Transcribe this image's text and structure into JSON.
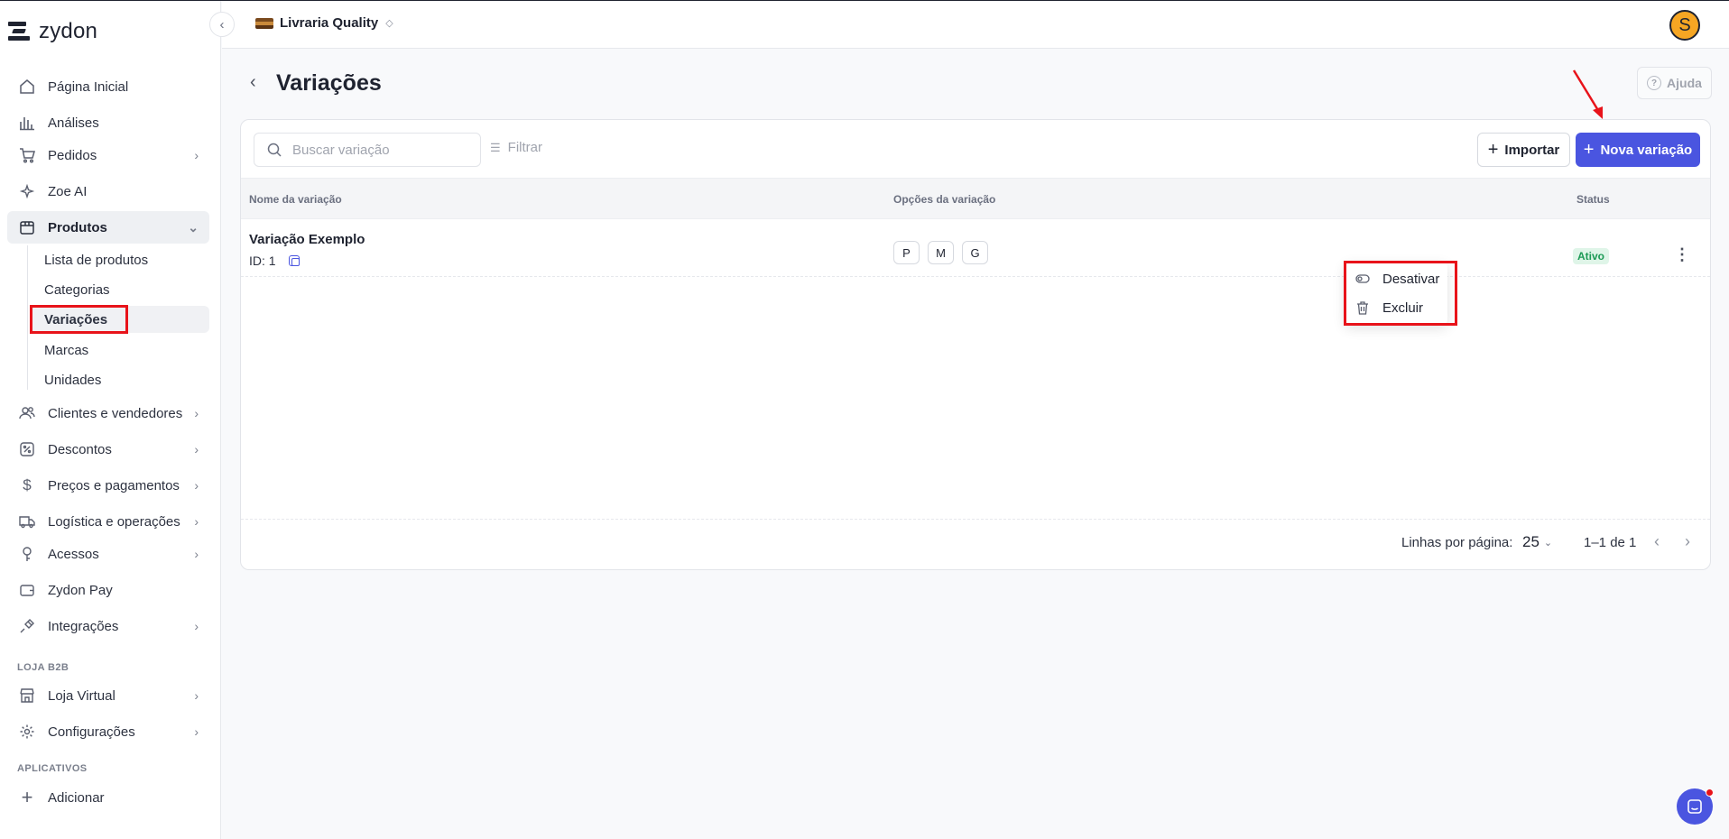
{
  "app": {
    "logo_text": "zydon",
    "store_name": "Livraria Quality",
    "avatar_initial": "S"
  },
  "sidebar": {
    "items": [
      {
        "label": "Página Inicial",
        "icon": "home-icon"
      },
      {
        "label": "Análises",
        "icon": "bar-chart-icon"
      },
      {
        "label": "Pedidos",
        "icon": "cart-icon"
      },
      {
        "label": "Zoe AI",
        "icon": "sparkle-icon"
      },
      {
        "label": "Produtos",
        "icon": "box-icon"
      }
    ],
    "sub_items": [
      "Lista de produtos",
      "Categorias",
      "Variações",
      "Marcas",
      "Unidades"
    ],
    "items_after": [
      {
        "label": "Clientes e vendedores",
        "icon": "users-icon"
      },
      {
        "label": "Descontos",
        "icon": "discount-icon"
      },
      {
        "label": "Preços e pagamentos",
        "icon": "dollar-icon"
      },
      {
        "label": "Logística e operações",
        "icon": "truck-icon"
      },
      {
        "label": "Acessos",
        "icon": "key-icon"
      },
      {
        "label": "Zydon Pay",
        "icon": "wallet-icon"
      },
      {
        "label": "Integrações",
        "icon": "plug-icon"
      }
    ],
    "section_b2b": "LOJA B2B",
    "b2b_items": [
      {
        "label": "Loja Virtual",
        "icon": "store-icon"
      },
      {
        "label": "Configurações",
        "icon": "gear-icon"
      }
    ],
    "section_apps": "APLICATIVOS",
    "add_label": "Adicionar"
  },
  "page": {
    "title": "Variações",
    "help_label": "Ajuda"
  },
  "toolbar": {
    "search_placeholder": "Buscar variação",
    "filter_label": "Filtrar",
    "import_label": "Importar",
    "new_label": "Nova variação"
  },
  "table": {
    "headers": [
      "Nome da variação",
      "Opções da variação",
      "Status"
    ],
    "rows": [
      {
        "name": "Variação Exemplo",
        "id_text": "ID: 1",
        "options": [
          "P",
          "M",
          "G"
        ],
        "status": "Ativo"
      }
    ]
  },
  "row_menu": {
    "items": [
      "Desativar",
      "Excluir"
    ]
  },
  "pagination": {
    "rows_label": "Linhas por página:",
    "rows_value": "25",
    "range": "1–1 de 1"
  },
  "colors": {
    "primary": "#4a55e0",
    "highlight": "#e8131a",
    "status_active_bg": "#dff5e8",
    "status_active_text": "#1c9a55"
  }
}
